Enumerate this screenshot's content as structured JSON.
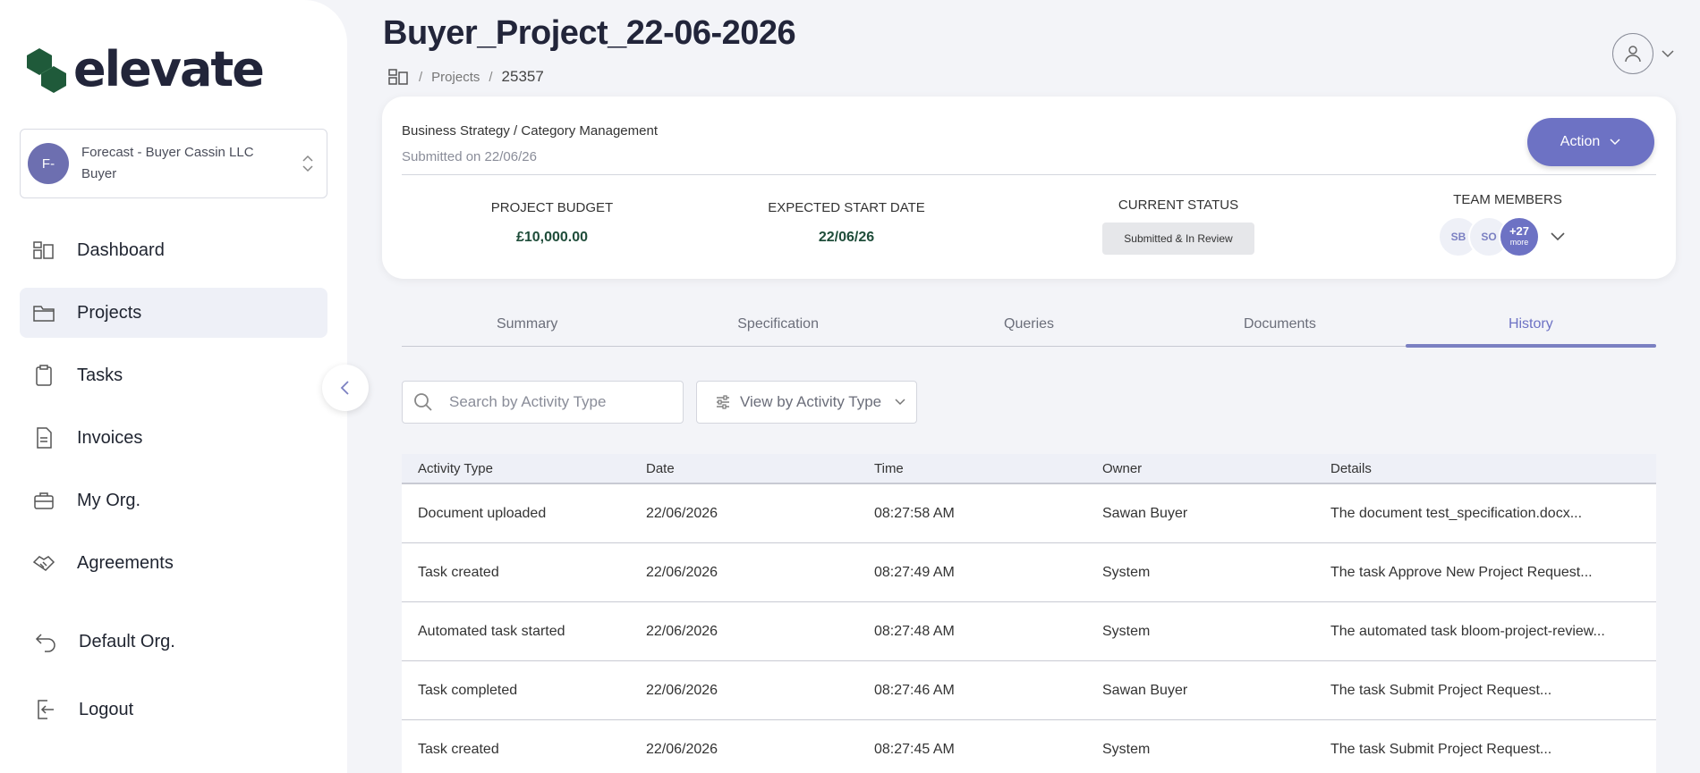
{
  "brand": {
    "logo_text": "elevate",
    "accent": "#6d72c4",
    "logo_color": "#2d5a3d"
  },
  "org": {
    "initials": "F-",
    "name": "Forecast - Buyer Cassin LLC",
    "role": "Buyer"
  },
  "nav": [
    {
      "label": "Dashboard",
      "icon": "dashboard-icon",
      "active": false
    },
    {
      "label": "Projects",
      "icon": "folder-icon",
      "active": true
    },
    {
      "label": "Tasks",
      "icon": "clipboard-icon",
      "active": false
    },
    {
      "label": "Invoices",
      "icon": "document-icon",
      "active": false
    },
    {
      "label": "My Org.",
      "icon": "briefcase-icon",
      "active": false
    },
    {
      "label": "Agreements",
      "icon": "handshake-icon",
      "active": false
    }
  ],
  "footer_nav": {
    "default_org": "Default Org.",
    "logout": "Logout"
  },
  "header": {
    "title": "Buyer_Project_22-06-2026",
    "breadcrumb": {
      "sep1": "/",
      "projects": "Projects",
      "sep2": "/",
      "current": "25357"
    }
  },
  "project": {
    "category": "Business Strategy / Category Management",
    "submitted": "Submitted on 22/06/26",
    "action_label": "Action",
    "budget_label": "Project Budget",
    "budget_value": "£10,000.00",
    "start_label": "Expected Start Date",
    "start_value": "22/06/26",
    "status_label": "Current Status",
    "status_value": "Submitted & In Review",
    "team_label": "Team Members",
    "team": [
      "SB",
      "SO"
    ],
    "team_more_count": "+27",
    "team_more_label": "more"
  },
  "tabs": [
    "Summary",
    "Specification",
    "Queries",
    "Documents",
    "History"
  ],
  "active_tab": "History",
  "filters": {
    "search_placeholder": "Search by Activity Type",
    "view_by": "View by Activity Type"
  },
  "table": {
    "columns": [
      "Activity Type",
      "Date",
      "Time",
      "Owner",
      "Details"
    ],
    "rows": [
      [
        "Document uploaded",
        "22/06/2026",
        "08:27:58 AM",
        "Sawan Buyer",
        "The document test_specification.docx..."
      ],
      [
        "Task created",
        "22/06/2026",
        "08:27:49 AM",
        "System",
        "The task Approve New Project Request..."
      ],
      [
        "Automated task started",
        "22/06/2026",
        "08:27:48 AM",
        "System",
        "The automated task bloom-project-review..."
      ],
      [
        "Task completed",
        "22/06/2026",
        "08:27:46 AM",
        "Sawan Buyer",
        "The task Submit Project Request..."
      ],
      [
        "Task created",
        "22/06/2026",
        "08:27:45 AM",
        "System",
        "The task Submit Project Request..."
      ]
    ]
  }
}
